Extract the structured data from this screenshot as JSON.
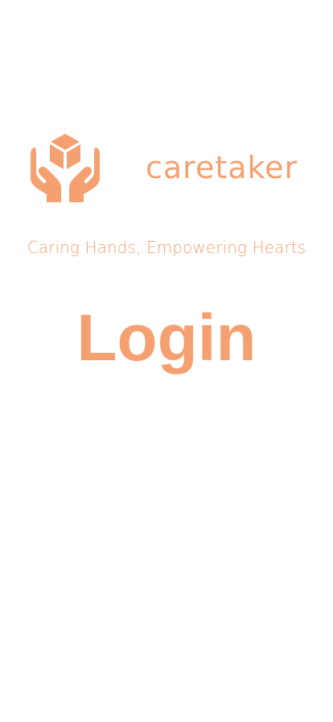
{
  "brand": {
    "name": "caretaker",
    "icon": "hands-box-icon",
    "color": "#f5a070"
  },
  "tagline": "Caring Hands, Empowering Hearts",
  "screen": {
    "title": "Login"
  }
}
